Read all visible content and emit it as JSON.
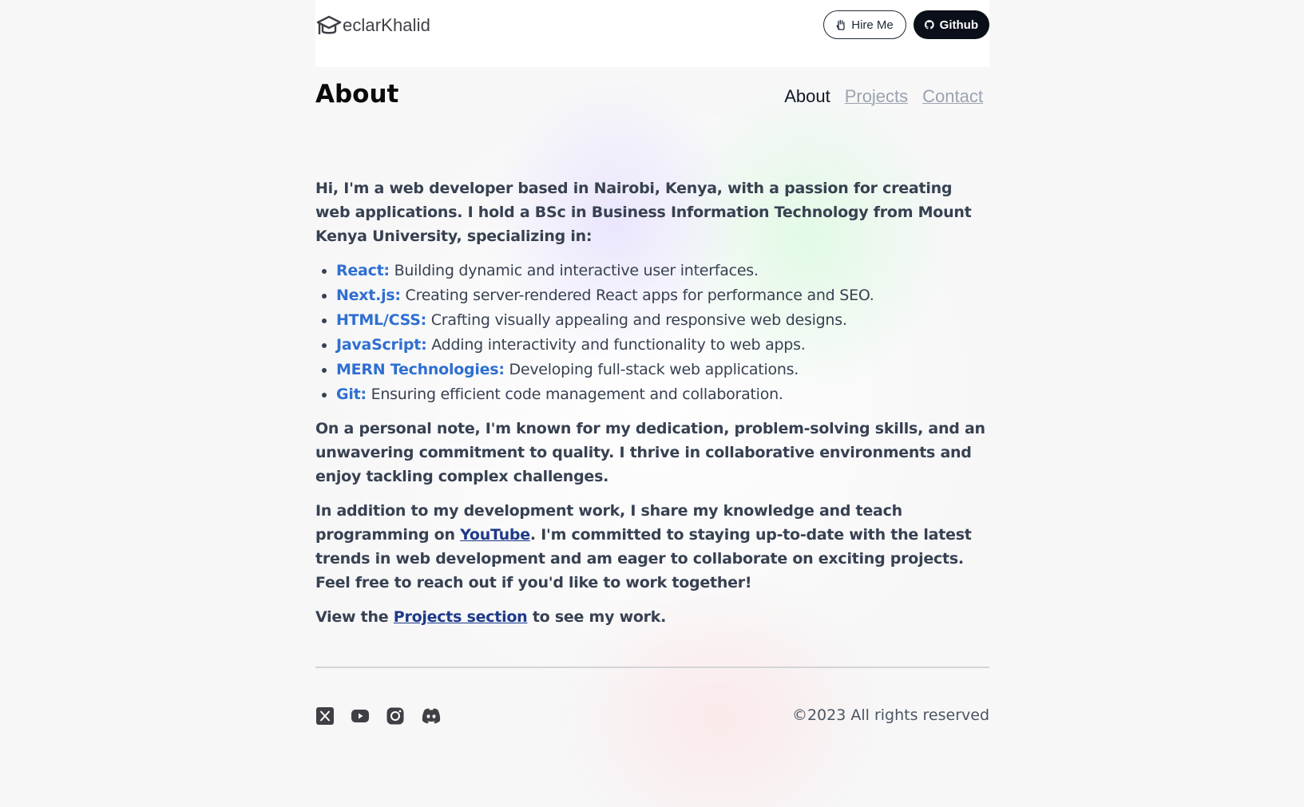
{
  "header": {
    "logo_text": "eclarKhalid",
    "hire_label": "Hire Me",
    "github_label": "Github"
  },
  "page": {
    "title": "About"
  },
  "nav": {
    "about": "About",
    "projects": "Projects",
    "contact": "Contact"
  },
  "intro": "Hi, I'm a web developer based in Nairobi, Kenya, with a passion for creating web applications. I hold a BSc in Business Information Technology from Mount Kenya University, specializing in:",
  "skills": [
    {
      "name": "React:",
      "desc": " Building dynamic and interactive user interfaces."
    },
    {
      "name": "Next.js:",
      "desc": " Creating server-rendered React apps for performance and SEO."
    },
    {
      "name": "HTML/CSS:",
      "desc": " Crafting visually appealing and responsive web designs."
    },
    {
      "name": "JavaScript:",
      "desc": " Adding interactivity and functionality to web apps."
    },
    {
      "name": "MERN Technologies:",
      "desc": " Developing full-stack web applications."
    },
    {
      "name": "Git:",
      "desc": " Ensuring efficient code management and collaboration."
    }
  ],
  "personal": "On a personal note, I'm known for my dedication, problem-solving skills, and an unwavering commitment to quality. I thrive in collaborative environments and enjoy tackling complex challenges.",
  "teach": {
    "before": "In addition to my development work, I share my knowledge and teach programming on ",
    "link": "YouTube",
    "after": ". I'm committed to staying up-to-date with the latest trends in web development and am eager to collaborate on exciting projects. Feel free to reach out if you'd like to work together!"
  },
  "view": {
    "before": "View the ",
    "link": "Projects section",
    "after": " to see my work."
  },
  "footer": {
    "copyright": "©2023 All rights reserved",
    "socials": [
      "x-icon",
      "youtube-icon",
      "instagram-icon",
      "discord-icon"
    ]
  }
}
